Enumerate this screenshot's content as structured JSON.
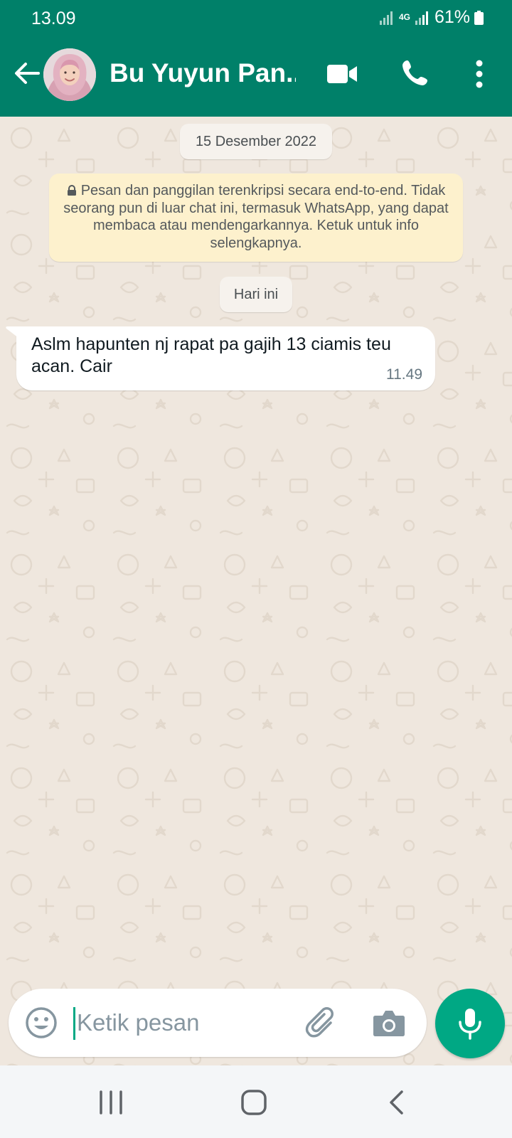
{
  "status_bar": {
    "time": "13.09",
    "network": "4G",
    "battery": "61%"
  },
  "header": {
    "contact_name": "Bu Yuyun Pan..."
  },
  "chat": {
    "date_chip": "15 Desember 2022",
    "encryption_notice": "Pesan dan panggilan terenkripsi secara end-to-end. Tidak seorang pun di luar chat ini, termasuk WhatsApp, yang dapat membaca atau mendengarkannya. Ketuk untuk info selengkapnya.",
    "today_chip": "Hari ini",
    "messages": [
      {
        "text": "Aslm hapunten nj rapat pa gajih 13 ciamis teu acan. Cair",
        "time": "11.49",
        "direction": "incoming"
      }
    ]
  },
  "composer": {
    "placeholder": "Ketik pesan"
  },
  "icons": {
    "back": "arrow-left-icon",
    "video": "video-call-icon",
    "call": "phone-icon",
    "more": "more-vert-icon",
    "emoji": "emoji-icon",
    "attach": "paperclip-icon",
    "camera": "camera-icon",
    "mic": "mic-icon"
  },
  "colors": {
    "header": "#008069",
    "accent": "#00a884",
    "chat_bg": "#efe7de",
    "notice_bg": "#fdf1cd"
  }
}
